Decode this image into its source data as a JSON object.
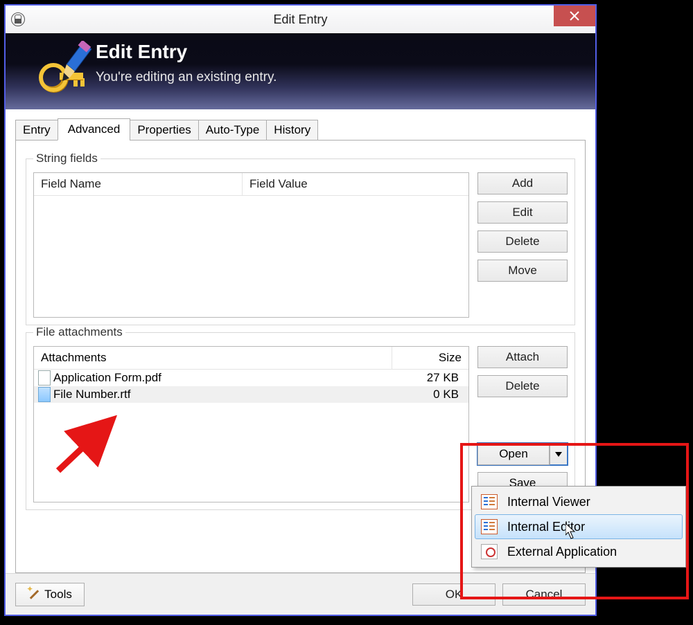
{
  "window": {
    "title": "Edit Entry",
    "banner_title": "Edit Entry",
    "banner_subtitle": "You're editing an existing entry."
  },
  "tabs": [
    "Entry",
    "Advanced",
    "Properties",
    "Auto-Type",
    "History"
  ],
  "active_tab_index": 1,
  "string_fields": {
    "legend": "String fields",
    "columns": [
      "Field Name",
      "Field Value"
    ],
    "rows": [],
    "buttons": {
      "add": "Add",
      "edit": "Edit",
      "delete": "Delete",
      "move": "Move"
    }
  },
  "file_attachments": {
    "legend": "File attachments",
    "columns": [
      "Attachments",
      "Size"
    ],
    "rows": [
      {
        "name": "Application Form.pdf",
        "size": "27 KB",
        "selected": false
      },
      {
        "name": "File Number.rtf",
        "size": "0 KB",
        "selected": true
      }
    ],
    "buttons": {
      "attach": "Attach",
      "delete": "Delete",
      "open": "Open",
      "save": "Save"
    }
  },
  "open_menu": {
    "items": [
      {
        "label": "Internal Viewer",
        "hover": false,
        "icon": "list"
      },
      {
        "label": "Internal Editor",
        "hover": true,
        "icon": "list"
      },
      {
        "label": "External Application",
        "hover": false,
        "icon": "ext"
      }
    ]
  },
  "footer": {
    "tools": "Tools",
    "ok": "OK",
    "cancel": "Cancel"
  }
}
